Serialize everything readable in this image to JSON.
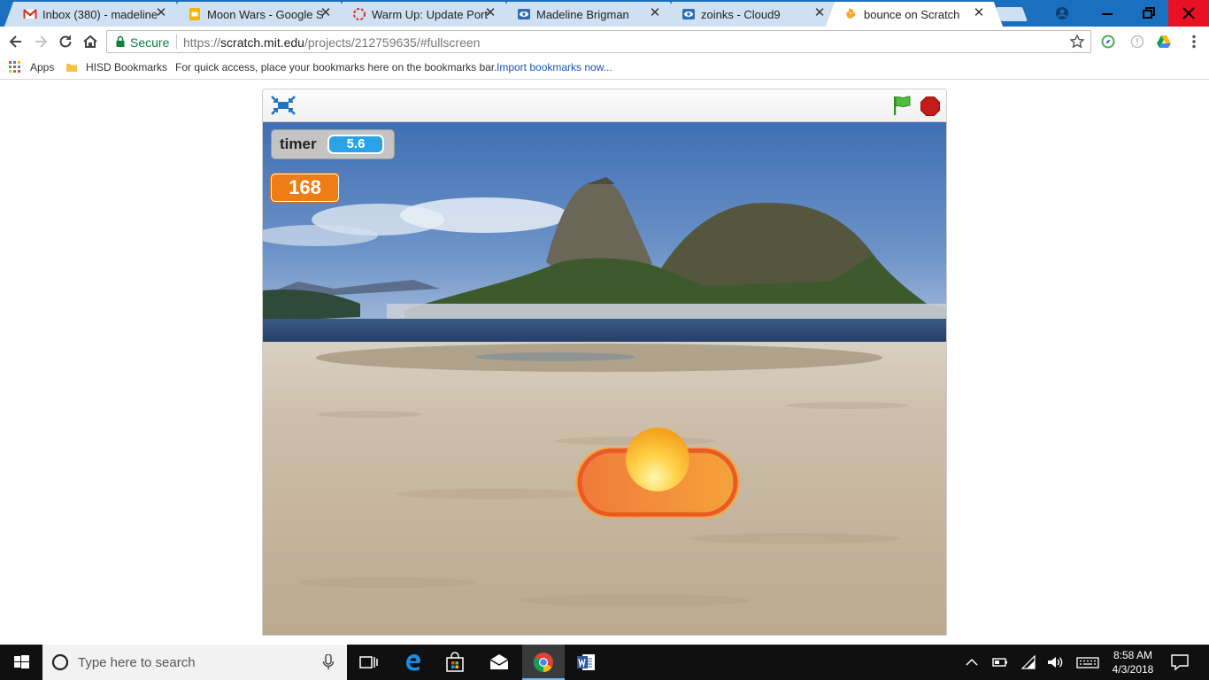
{
  "browser": {
    "tabs": [
      {
        "title": "Inbox (380) - madeline",
        "icon": "gmail-icon"
      },
      {
        "title": "Moon Wars - Google Sl",
        "icon": "google-slides-icon"
      },
      {
        "title": "Warm Up: Update Portf",
        "icon": "loading-spinner-icon"
      },
      {
        "title": "Madeline Brigman",
        "icon": "eye-icon"
      },
      {
        "title": "zoinks - Cloud9",
        "icon": "cloud9-icon"
      },
      {
        "title": "bounce on Scratch",
        "icon": "scratch-icon",
        "active": true
      }
    ],
    "toolbar": {
      "security_label": "Secure",
      "url_scheme": "https://",
      "url_host": "scratch.mit.edu",
      "url_path": "/projects/212759635/#fullscreen"
    },
    "bookmarks": {
      "apps_label": "Apps",
      "folder_label": "HISD Bookmarks",
      "hint_text": "For quick access, place your bookmarks here on the bookmarks bar.",
      "import_link": "Import bookmarks now..."
    }
  },
  "scratch": {
    "timer_monitor": {
      "label": "timer",
      "value": "5.6"
    },
    "score_monitor": {
      "value": "168"
    },
    "backdrop": "beach-rio",
    "sprites": [
      "paddle",
      "ball"
    ],
    "colors": {
      "accent_orange": "#ee7d16",
      "monitor_blue": "#2aa3e6",
      "flag_green": "#4cbf3a",
      "stop_red": "#c41a1a"
    }
  },
  "taskbar": {
    "search_placeholder": "Type here to search",
    "time": "8:58 AM",
    "date": "4/3/2018"
  }
}
